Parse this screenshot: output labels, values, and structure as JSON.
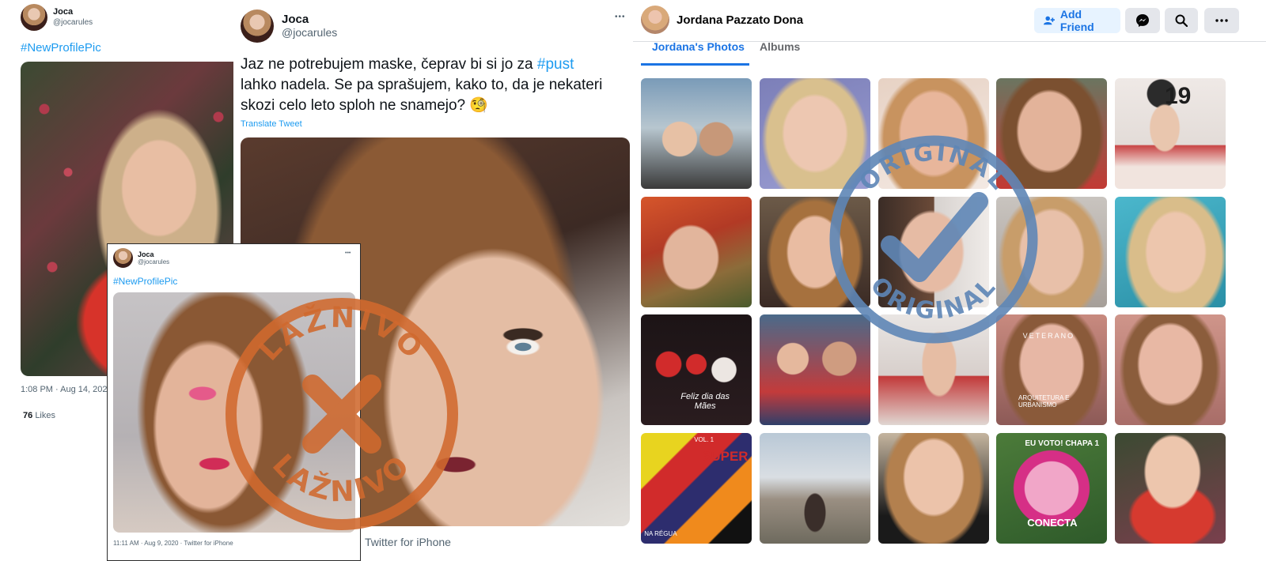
{
  "tweet_left": {
    "name": "Joca",
    "handle": "@jocarules",
    "text": "#NewProfilePic",
    "timestamp": "1:08 PM · Aug 14, 2020",
    "likes_count": "76",
    "likes_label": "Likes"
  },
  "tweet_center": {
    "name": "Joca",
    "handle": "@jocarules",
    "text_line1_a": "Jaz ne potrebujem maske, čeprav bi si jo za ",
    "text_hashtag": "#pust",
    "text_line2": "lahko nadela. Se pa sprašujem, kako to, da je nekateri",
    "text_line3": "skozi celo leto sploh ne snamejo? 🧐",
    "translate": "Translate Tweet",
    "source": "Twitter for iPhone",
    "more": "•••"
  },
  "tweet_inset": {
    "name": "Joca",
    "handle": "@jocarules",
    "text": "#NewProfilePic",
    "meta": "11:11 AM · Aug 9, 2020 · Twitter for iPhone",
    "more": "•••"
  },
  "facebook": {
    "profile_name": "Jordana Pazzato Dona",
    "add_friend": "Add Friend",
    "tabs": [
      "Jordana's Photos",
      "Albums"
    ],
    "accent": "#1b74e4",
    "photo_texts": {
      "caption_mothers_day": "Feliz dia das Mães",
      "veterano": "VETERANO",
      "arquitetura": "ARQUITETURA E URBANISMO",
      "eu_voto": "EU VOTO! CHAPA 1",
      "conecta": "CONECTA",
      "super": "SUPER",
      "vol": "VOL. 1",
      "na_regua": "NA RÉGUA",
      "balloon": "19"
    }
  },
  "stamps": {
    "fake_text": "LAŽNIVO",
    "fake_color": "#d0692e",
    "original_text": "ORIGINAL",
    "original_color": "#5e86b6"
  }
}
